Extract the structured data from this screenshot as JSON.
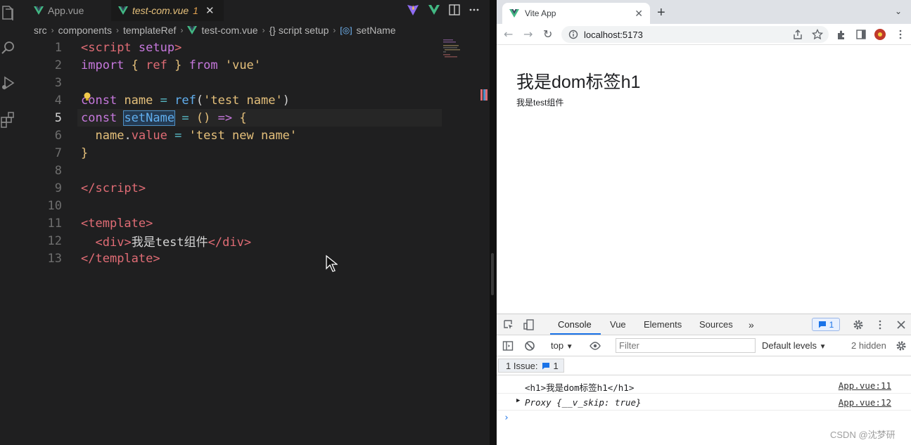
{
  "editor": {
    "tabs": [
      {
        "label": "App.vue",
        "active": false
      },
      {
        "label": "test-com.vue",
        "badge": "1",
        "active": true
      }
    ],
    "breadcrumb": [
      "src",
      "components",
      "templateRef",
      "test-com.vue",
      "{} script setup",
      "setName"
    ],
    "line_numbers": [
      "1",
      "2",
      "3",
      "4",
      "5",
      "6",
      "7",
      "8",
      "9",
      "10",
      "11",
      "12",
      "13"
    ],
    "current_line": "5"
  },
  "browser": {
    "tab_title": "Vite App",
    "url": "localhost:5173",
    "page": {
      "heading": "我是dom标签h1",
      "text": "我是test组件"
    },
    "devtools": {
      "tabs": [
        "Console",
        "Vue",
        "Elements",
        "Sources"
      ],
      "message_count": "1",
      "context": "top",
      "filter_placeholder": "Filter",
      "levels": "Default levels",
      "hidden": "2 hidden",
      "issues_label": "1 Issue:",
      "issues_count": "1",
      "logs": [
        {
          "message": "<h1>我是dom标签h1</h1>",
          "source": "App.vue:11"
        },
        {
          "message": "Proxy {__v_skip: true}",
          "source": "App.vue:12"
        }
      ]
    }
  },
  "watermark": "CSDN @沈梦研",
  "colors": {
    "editor_bg": "#1f1f20",
    "vue_green": "#42b883",
    "devtools_blue": "#1a73e8"
  }
}
